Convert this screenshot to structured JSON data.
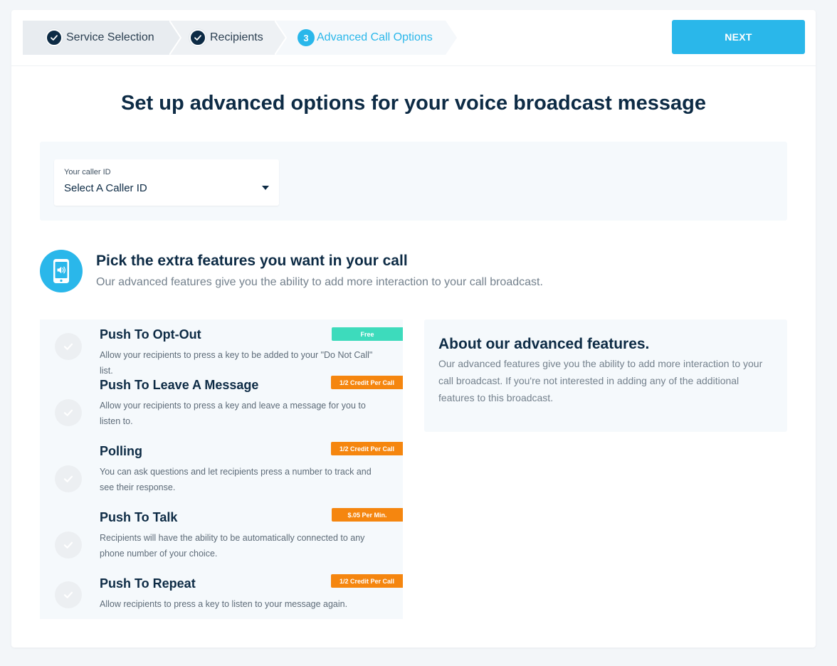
{
  "stepper": {
    "steps": [
      {
        "label": "Service Selection",
        "state": "done",
        "icon": "check-icon"
      },
      {
        "label": "Recipients",
        "state": "done",
        "icon": "check-icon"
      },
      {
        "number": "3",
        "label": "Advanced Call Options",
        "state": "active"
      }
    ]
  },
  "header": {
    "next_label": "NEXT"
  },
  "main": {
    "title": "Set up advanced options for your voice broadcast message"
  },
  "caller_id": {
    "label": "Your caller ID",
    "value": "Select A Caller ID",
    "icon": "chevron-down-icon"
  },
  "features_section": {
    "icon": "phone-speaker-icon",
    "title": "Pick the extra features you want in your call",
    "subtitle": "Our advanced features give you the ability to add more interaction to your call broadcast."
  },
  "features": [
    {
      "title": "Push To Opt-Out",
      "description": "Allow your recipients to press a key to be added to your \"Do Not Call\" list.",
      "badge": "Free",
      "badge_color": "#3ddbbc"
    },
    {
      "title": "Push To Leave A Message",
      "description": "Allow your recipients to press a key and leave a message for you to listen to.",
      "badge": "1/2 Credit Per Call",
      "badge_color": "#f5860f"
    },
    {
      "title": "Polling",
      "description": "You can ask questions and let recipients press a number to track and see their response.",
      "badge": "1/2 Credit Per Call",
      "badge_color": "#f5860f"
    },
    {
      "title": "Push To Talk",
      "description": "Recipients will have the ability to be automatically connected to any phone number of your choice.",
      "badge": "$.05 Per Min.",
      "badge_color": "#f5860f"
    },
    {
      "title": "Push To Repeat",
      "description": "Allow recipients to press a key to listen to your message again.",
      "badge": "1/2 Credit Per Call",
      "badge_color": "#f5860f"
    }
  ],
  "about": {
    "title": "About our advanced features.",
    "text": "Our advanced features give you the ability to add more interaction to your call broadcast. If you're not interested in adding any of the additional features to this broadcast."
  },
  "colors": {
    "accent": "#2ab7ea",
    "primary_text": "#0d2b45",
    "free_badge": "#3ddbbc",
    "paid_badge": "#f5860f"
  }
}
